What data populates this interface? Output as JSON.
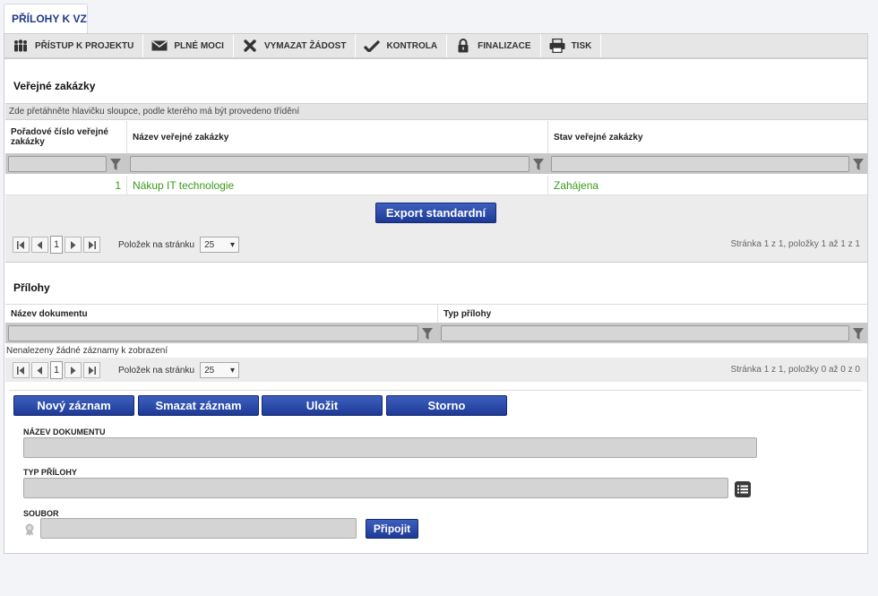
{
  "page_tab": "PŘÍLOHY K VZ",
  "toolbar": {
    "items": [
      {
        "label": "PŘÍSTUP K PROJEKTU",
        "icon": "people-icon"
      },
      {
        "label": "PLNÉ MOCI",
        "icon": "envelope-icon"
      },
      {
        "label": "VYMAZAT ŽÁDOST",
        "icon": "x-icon"
      },
      {
        "label": "KONTROLA",
        "icon": "check-icon"
      },
      {
        "label": "FINALIZACE",
        "icon": "lock-icon"
      },
      {
        "label": "TISK",
        "icon": "printer-icon"
      }
    ]
  },
  "contracts": {
    "title": "Veřejné zakázky",
    "group_hint": "Zde přetáhněte hlavičku sloupce, podle kterého má být provedeno třídění",
    "columns": [
      "Pořadové číslo veřejné zakázky",
      "Název veřejné zakázky",
      "Stav veřejné zakázky"
    ],
    "rows": [
      {
        "number": "1",
        "name": "Nákup IT technologie",
        "status": "Zahájena"
      }
    ],
    "export_label": "Export standardní",
    "pager": {
      "page": "1",
      "per_page_label": "Položek na stránku",
      "per_page": "25",
      "info": "Stránka 1 z 1, položky 1 až 1 z 1"
    }
  },
  "attachments": {
    "title": "Přílohy",
    "columns": [
      "Název dokumentu",
      "Typ přílohy"
    ],
    "empty_text": "Nenalezeny žádné záznamy k zobrazení",
    "pager": {
      "page": "1",
      "per_page_label": "Položek na stránku",
      "per_page": "25",
      "info": "Stránka 1 z 1, položky 0 až 0 z 0"
    }
  },
  "actions": {
    "new": "Nový záznam",
    "delete": "Smazat záznam",
    "save": "Uložit",
    "cancel": "Storno"
  },
  "form": {
    "doc_name_label": "NÁZEV DOKUMENTU",
    "doc_name_value": "",
    "type_label": "TYP PŘÍLOHY",
    "type_value": "",
    "file_label": "SOUBOR",
    "file_value": "",
    "attach_button": "Připojit"
  },
  "colors": {
    "accent": "#1e3a96",
    "status_green": "#3a9a1a"
  }
}
